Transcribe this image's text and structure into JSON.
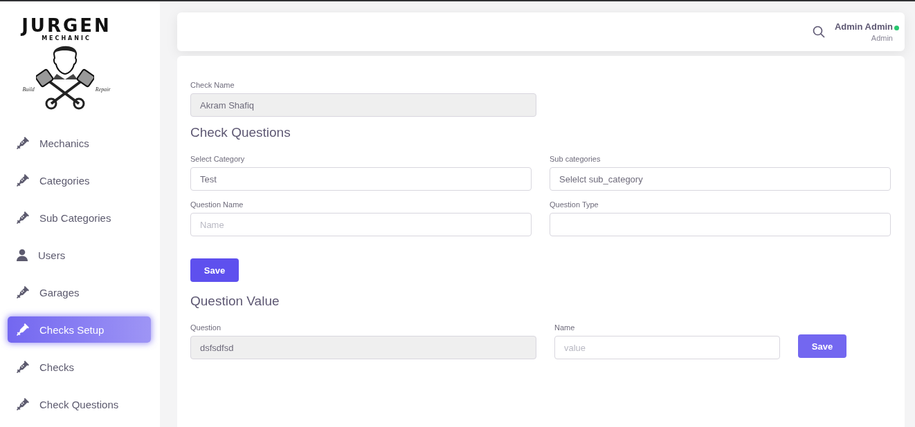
{
  "logo": {
    "title": "JURGEN",
    "subtitle": "MECHANIC",
    "left_tag": "Build",
    "right_tag": "Repair"
  },
  "sidebar": {
    "items": [
      {
        "label": "Mechanics",
        "kind": "tool",
        "selected": false
      },
      {
        "label": "Categories",
        "kind": "tool",
        "selected": false
      },
      {
        "label": "Sub Categories",
        "kind": "tool",
        "selected": false
      },
      {
        "label": "Users",
        "kind": "user",
        "selected": false
      },
      {
        "label": "Garages",
        "kind": "tool",
        "selected": false
      },
      {
        "label": "Checks Setup",
        "kind": "tool",
        "selected": true
      },
      {
        "label": "Checks",
        "kind": "tool",
        "selected": false
      },
      {
        "label": "Check Questions",
        "kind": "tool",
        "selected": false
      }
    ]
  },
  "header": {
    "user_name": "Admin Admin",
    "user_role": "Admin",
    "online": true
  },
  "check_name": {
    "label": "Check Name",
    "value": "Akram Shafiq",
    "disabled": true
  },
  "check_questions": {
    "title": "Check Questions",
    "fields": [
      {
        "label": "Select Category",
        "value": "Test",
        "disabled": false
      },
      {
        "label": "Sub categories",
        "value": "Selelct sub_category",
        "disabled": false
      },
      {
        "label": "Question Name",
        "placeholder": "Name",
        "disabled": false
      },
      {
        "label": "Question Type",
        "disabled": false
      }
    ],
    "button": "Save"
  },
  "question_value": {
    "title": "Question Value",
    "fields": [
      {
        "label": "Question",
        "value": "dsfsdfsd",
        "disabled": true
      },
      {
        "label": "Name",
        "placeholder": "value",
        "disabled": false
      }
    ],
    "button": "Save"
  }
}
